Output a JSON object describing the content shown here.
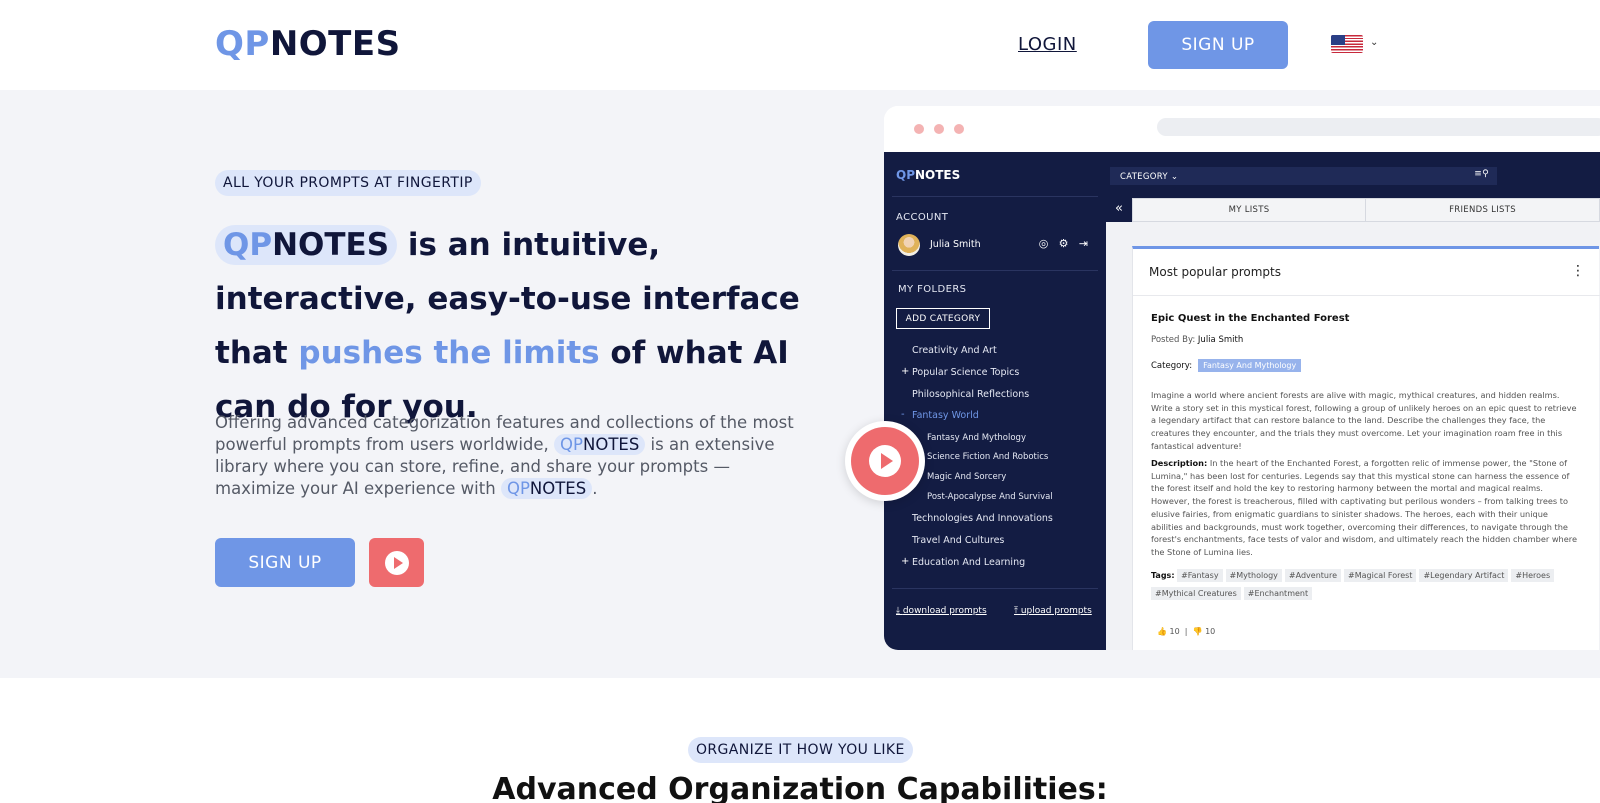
{
  "header": {
    "logo_qp": "QP",
    "logo_notes": "NOTES",
    "login": "LOGIN",
    "signup": "SIGN UP",
    "language_flag": "us-flag-icon"
  },
  "hero": {
    "tagline": "ALL YOUR PROMPTS AT FINGERTIP",
    "headline": {
      "qp": "QP",
      "notes": "NOTES",
      "part1": " is an intuitive, interactive, easy-to-use interface that ",
      "accent": "pushes the limits",
      "part2": " of what AI can do for you."
    },
    "description": {
      "part1": "Offering advanced categorization features and collections of the most powerful prompts from users worldwide, ",
      "part2": " is an extensive library where you can store, refine, and share your prompts — maximize your AI experience with ",
      "part3": "."
    },
    "signup": "SIGN UP",
    "play_icon": "play-icon"
  },
  "mockup": {
    "logo_qp": "QP",
    "logo_notes": "NOTES",
    "account_label": "ACCOUNT",
    "user_name": "Julia Smith",
    "folders_label": "MY FOLDERS",
    "add_category": "ADD CATEGORY",
    "folders": [
      {
        "label": "Creativity And Art"
      },
      {
        "label": "Popular Science Topics"
      },
      {
        "label": "Philosophical Reflections"
      },
      {
        "label": "Fantasy World"
      },
      {
        "label": "Fantasy And Mythology"
      },
      {
        "label": "Science Fiction And Robotics"
      },
      {
        "label": "Magic And Sorcery"
      },
      {
        "label": "Post-Apocalypse And Survival"
      },
      {
        "label": "Technologies And Innovations"
      },
      {
        "label": "Travel And Cultures"
      },
      {
        "label": "Education And Learning"
      }
    ],
    "download": "download prompts",
    "upload": "upload prompts",
    "category_select": "CATEGORY",
    "tabs": [
      "MY LISTS",
      "FRIENDS LISTS"
    ],
    "card_title": "Most popular prompts",
    "prompt": {
      "title": "Epic Quest in the Enchanted Forest",
      "posted_by_label": "Posted By:",
      "posted_by": "Julia Smith",
      "category_label": "Category:",
      "category": "Fantasy And Mythology",
      "body": "Imagine a world where ancient forests are alive with magic, mythical creatures, and hidden realms. Write a story set in this mystical forest, following a group of unlikely heroes on an epic quest to retrieve a legendary artifact that can restore balance to the land. Describe the challenges they face, the creatures they encounter, and the trials they must overcome. Let your imagination roam free in this fantastical adventure!",
      "description_label": "Description:",
      "description": "In the heart of the Enchanted Forest, a forgotten relic of immense power, the \"Stone of Lumina,\" has been lost for centuries. Legends say that this mystical stone can harness the essence of the forest itself and hold the key to restoring harmony between the mortal and magical realms.  However, the forest is treacherous, filled with captivating but perilous wonders – from talking trees to elusive fairies, from enigmatic guardians to sinister shadows. The heroes, each with their unique abilities and backgrounds, must work together, overcoming their differences, to navigate through the forest's enchantments, face tests of valor and wisdom, and ultimately reach the hidden chamber where the Stone of Lumina lies.",
      "tags_label": "Tags:",
      "tags": [
        "#Fantasy",
        "#Mythology",
        "#Adventure",
        "#Magical Forest",
        "#Legendary Artifact",
        "#Heroes",
        "#Mythical Creatures",
        "#Enchantment"
      ],
      "likes": "10",
      "dislikes": "10"
    }
  },
  "section": {
    "pill": "ORGANIZE IT HOW YOU LIKE",
    "title": "Advanced Organization Capabilities:"
  },
  "colors": {
    "accent": "#6f96e6",
    "navy": "#131c43",
    "red": "#ee6b6e"
  }
}
